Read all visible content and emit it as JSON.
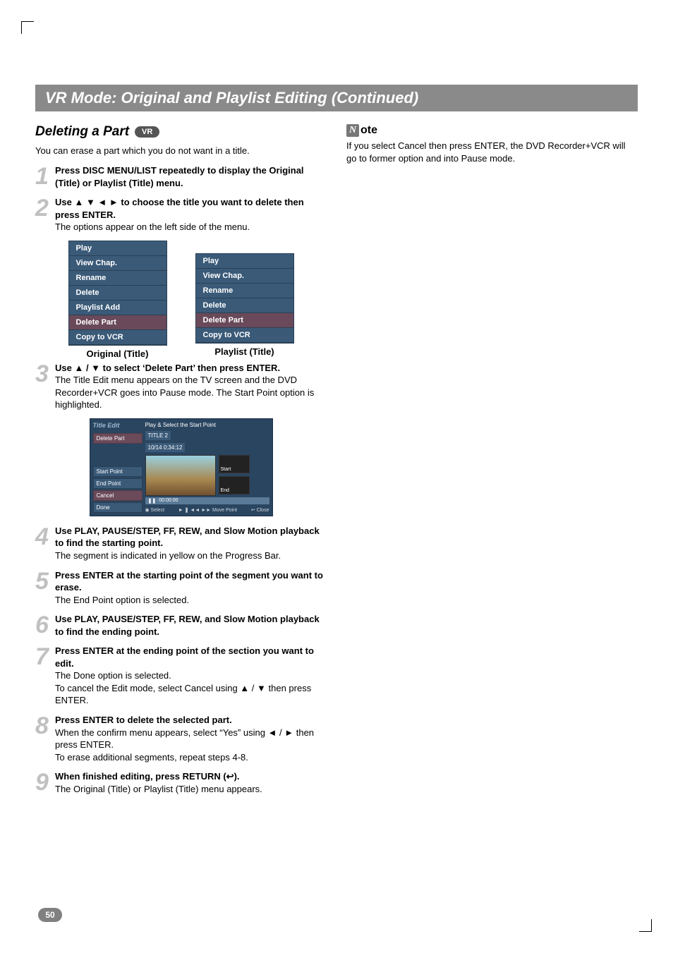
{
  "header": {
    "title": "VR Mode: Original and Playlist Editing (Continued)"
  },
  "left": {
    "sectionTitle": "Deleting a Part",
    "badge": "VR",
    "intro": "You can erase a part which you do not want in a title.",
    "steps": {
      "s1": {
        "num": "1",
        "bold": "Press DISC MENU/LIST repeatedly to display the Original (Title) or Playlist (Title) menu."
      },
      "s2": {
        "num": "2",
        "bold": "Use ▲ ▼ ◄ ► to choose the title you want to delete then press ENTER.",
        "text": "The options appear on the left side of the menu."
      },
      "s3": {
        "num": "3",
        "bold": "Use ▲ / ▼ to select ‘Delete Part’ then press ENTER.",
        "text": "The Title Edit menu appears on the TV screen and the DVD Recorder+VCR goes into Pause mode. The Start Point option is highlighted."
      },
      "s4": {
        "num": "4",
        "bold": "Use PLAY, PAUSE/STEP, FF, REW, and Slow Motion playback to find the starting point.",
        "text": "The segment is indicated in yellow on the Progress Bar."
      },
      "s5": {
        "num": "5",
        "bold": "Press ENTER at the starting point of the segment you want to erase.",
        "text": "The End Point option is selected."
      },
      "s6": {
        "num": "6",
        "bold": "Use PLAY, PAUSE/STEP, FF, REW, and Slow Motion playback to find the ending point."
      },
      "s7": {
        "num": "7",
        "bold": "Press ENTER at the ending point of the section you want to edit.",
        "text": "The Done option is selected.\nTo cancel the Edit mode, select Cancel using ▲ / ▼ then press ENTER."
      },
      "s8": {
        "num": "8",
        "bold": "Press ENTER to delete the selected part.",
        "text": "When the confirm menu appears, select “Yes” using ◄ / ► then press ENTER.\nTo erase additional segments, repeat steps 4-8."
      },
      "s9": {
        "num": "9",
        "bold": "When finished editing, press RETURN (↩).",
        "text": "The Original (Title) or Playlist (Title) menu appears."
      }
    },
    "menus": {
      "original": {
        "items": [
          "Play",
          "View Chap.",
          "Rename",
          "Delete",
          "Playlist Add",
          "Delete Part",
          "Copy to VCR"
        ],
        "caption": "Original (Title)"
      },
      "playlist": {
        "items": [
          "Play",
          "View Chap.",
          "Rename",
          "Delete",
          "Delete Part",
          "Copy to VCR"
        ],
        "caption": "Playlist (Title)"
      }
    },
    "titleEdit": {
      "panelLabel": "Title Edit",
      "leftButtons": [
        "Delete Part",
        "Start Point",
        "End Point",
        "Cancel",
        "Done"
      ],
      "topLine": "Play & Select the Start Point",
      "titleLine1": "TITLE 2",
      "titleLine2": "10/14    0:34:12",
      "thumb1": "Start",
      "thumb2": "End",
      "progressPause": "❚❚",
      "progressTime": "00:00:00",
      "footerSelect": "◉ Select",
      "footerMove": "► ❚ ◄◄ ►► Move Point",
      "footerClose": "↩ Close"
    }
  },
  "right": {
    "noteIcon": "N",
    "noteSuffix": "ote",
    "noteText": "If you select Cancel then press ENTER, the DVD Recorder+VCR will go to former option and into Pause mode."
  },
  "pageNumber": "50"
}
